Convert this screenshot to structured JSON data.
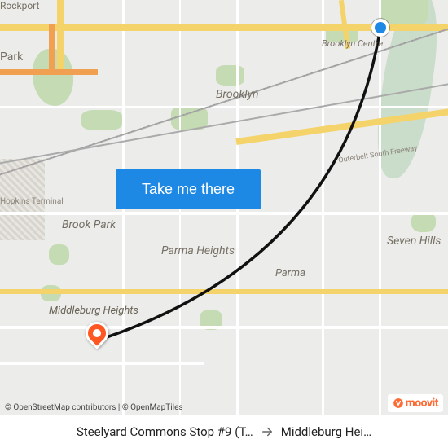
{
  "map": {
    "labels": {
      "rockport": "Rockport",
      "park": "Park",
      "brooklyn": "Brooklyn",
      "brooklyn_centre": "Brooklyn Centre",
      "brook_park": "Brook Park",
      "parma_heights": "Parma Heights",
      "parma": "Parma",
      "seven_hills": "Seven Hills",
      "middleburg": "Middleburg\nHeights",
      "hopkins": "Hopkins\nTerminal",
      "outerbelt": "Outerbelt South Freeway"
    },
    "cta_label": "Take me there",
    "attribution": "© OpenStreetMap contributors | © OpenMapTiles",
    "brand": "moovit"
  },
  "route": {
    "from": "Steelyard Commons Stop #9 (T…",
    "to": "Middleburg Hei…"
  }
}
